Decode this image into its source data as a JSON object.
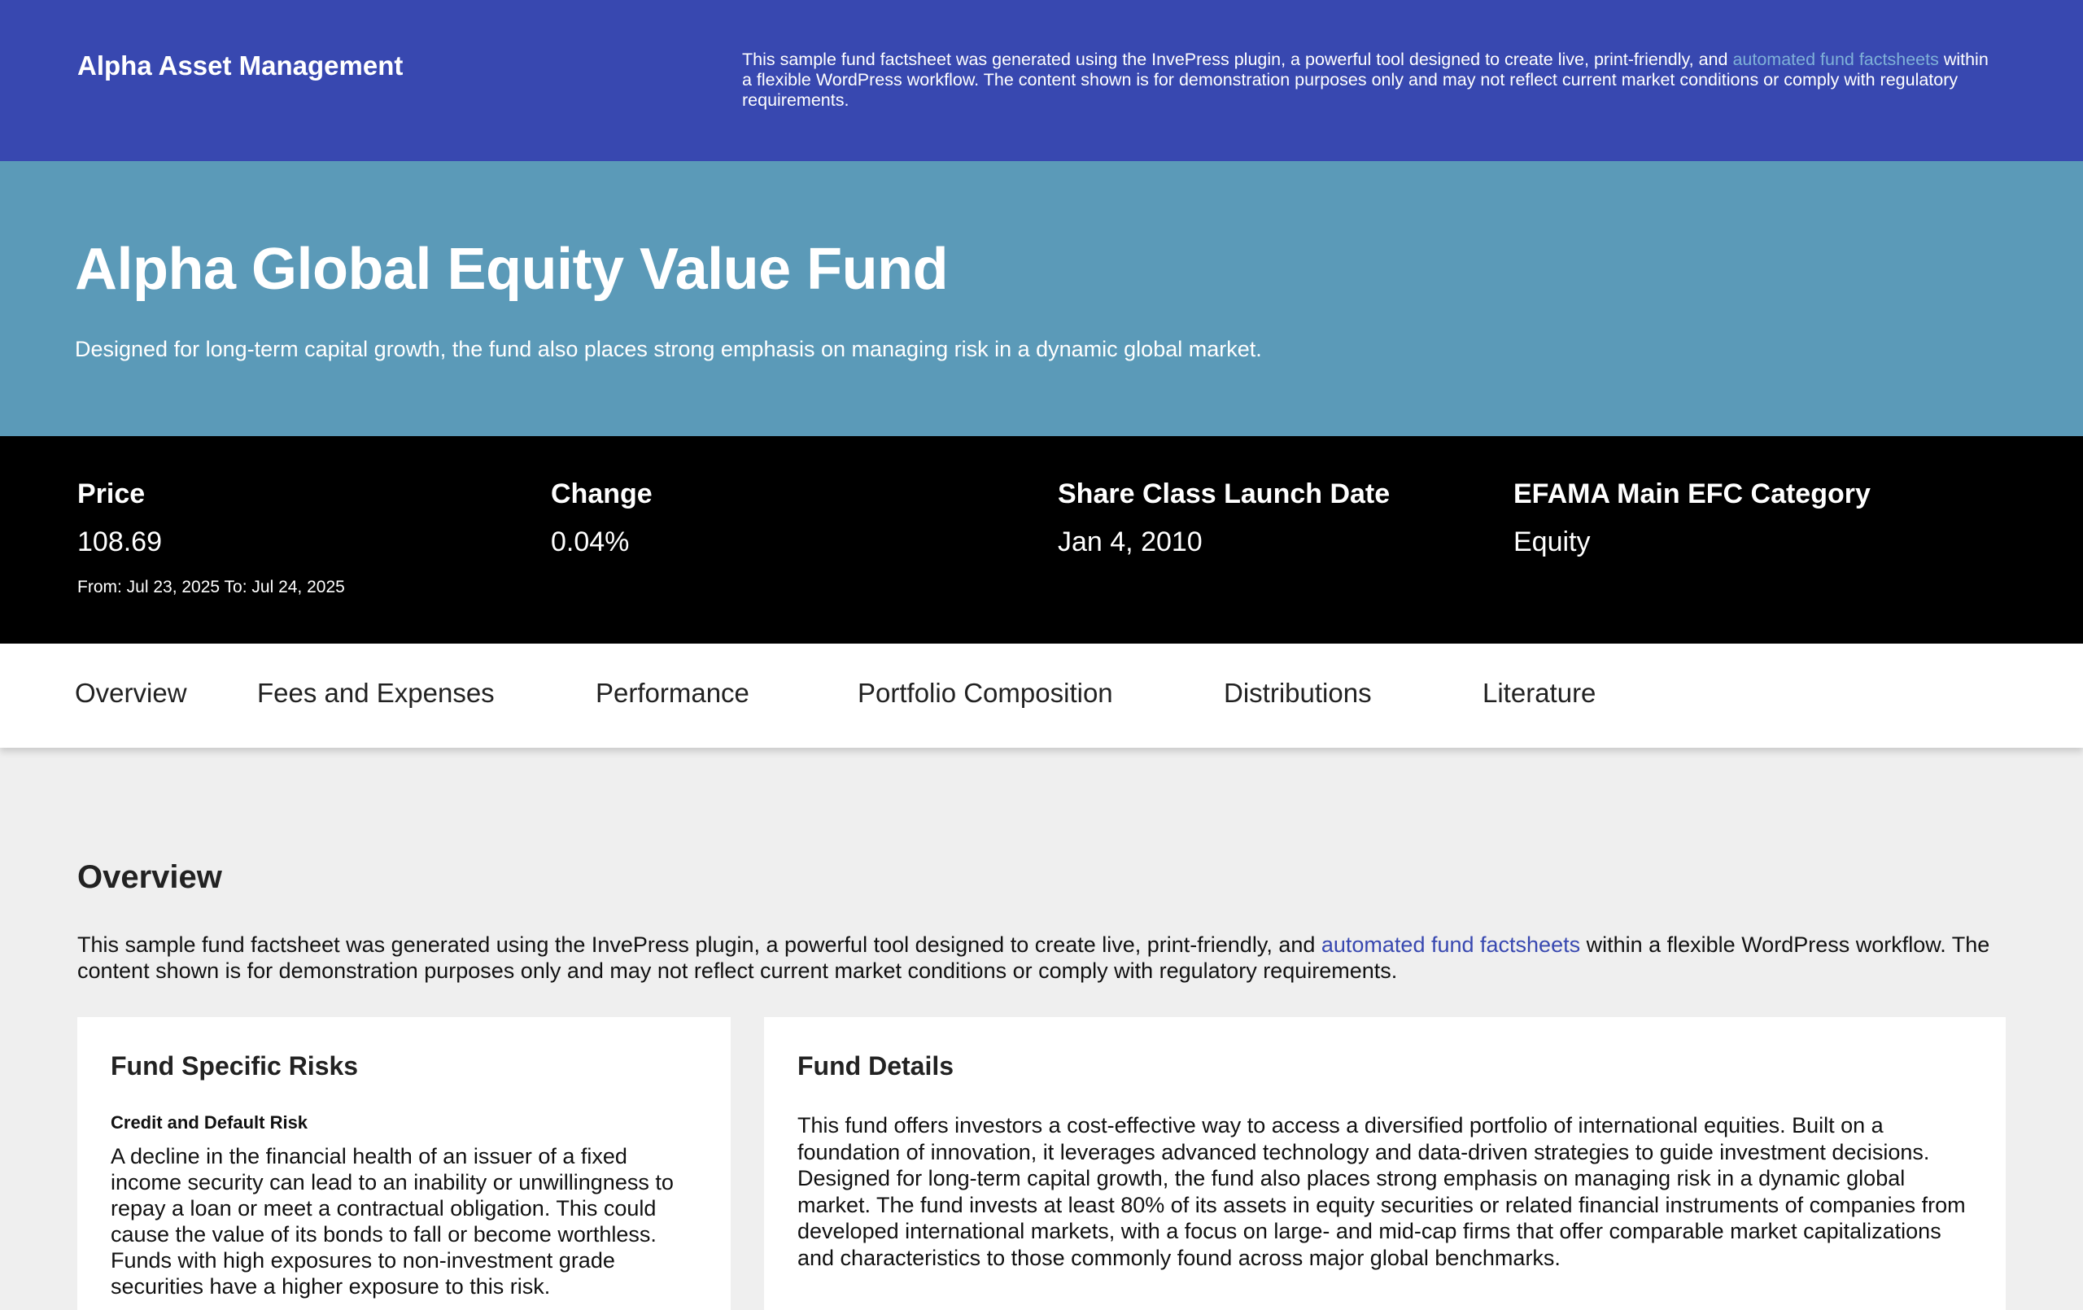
{
  "header": {
    "brand": "Alpha Asset Management",
    "disclaimer_before": "This sample fund factsheet was generated using the InvePress plugin, a powerful tool designed to create live, print-friendly, and ",
    "disclaimer_link": "automated fund factsheets",
    "disclaimer_after": " within a flexible WordPress workflow. The content shown is for demonstration purposes only and may not reflect current market conditions or comply with regulatory requirements."
  },
  "hero": {
    "title": "Alpha Global Equity Value Fund",
    "subtitle": "Designed for long-term capital growth, the fund also places strong emphasis on managing risk in a dynamic global market."
  },
  "stats": {
    "price_label": "Price",
    "price_value": "108.69",
    "price_note": "From: Jul 23, 2025 To: Jul 24, 2025",
    "change_label": "Change",
    "change_value": "0.04%",
    "launch_label": "Share Class Launch Date",
    "launch_value": "Jan 4, 2010",
    "category_label": "EFAMA Main EFC Category",
    "category_value": "Equity"
  },
  "tabs": [
    "Overview",
    "Fees and Expenses",
    "Performance",
    "Portfolio Composition",
    "Distributions",
    "Literature"
  ],
  "overview": {
    "title": "Overview",
    "text_before": "This sample fund factsheet was generated using the InvePress plugin, a powerful tool designed to create live, print-friendly, and ",
    "text_link": "automated fund factsheets",
    "text_after": " within a flexible WordPress workflow. The content shown is for demonstration purposes only and may not reflect current market conditions or comply with regulatory requirements."
  },
  "risks": {
    "title": "Fund Specific Risks",
    "subhead": "Credit and Default Risk",
    "body": "A decline in the financial health of an issuer of a fixed income security can lead to an inability or unwillingness to repay a loan or meet a contractual obligation. This could cause the value of its bonds to fall or become worthless. Funds with high exposures to non-investment grade securities have a higher exposure to this risk."
  },
  "details": {
    "title": "Fund Details",
    "body": "This fund offers investors a cost-effective way to access a diversified portfolio of international equities. Built on a foundation of innovation, it leverages advanced technology and data-driven strategies to guide investment decisions. Designed for long-term capital growth, the fund also places strong emphasis on managing risk in a dynamic global market. The fund invests at least 80% of its assets in equity securities or related financial instruments of companies from developed international markets, with a focus on large- and mid-cap firms that offer comparable market capitalizations and characteristics to those commonly found across major global benchmarks."
  }
}
